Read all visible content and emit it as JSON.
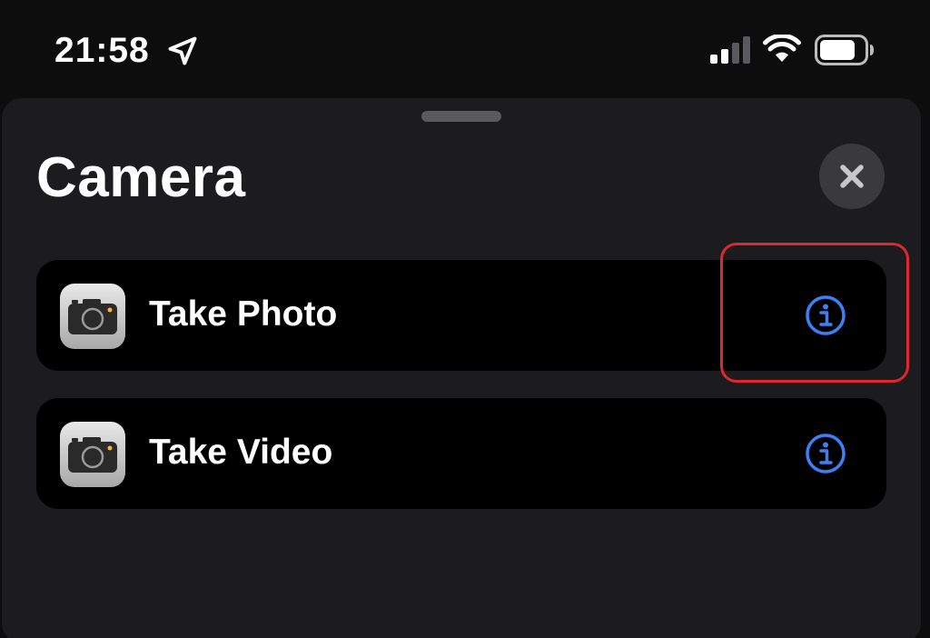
{
  "status_bar": {
    "time": "21:58",
    "icons": [
      "location-arrow-icon",
      "signal-icon",
      "wifi-icon",
      "battery-icon"
    ]
  },
  "sheet": {
    "title": "Camera",
    "close_icon": "close-icon",
    "actions": [
      {
        "label": "Take Photo",
        "app_icon": "camera-app-icon",
        "info_icon": "info-icon"
      },
      {
        "label": "Take Video",
        "app_icon": "camera-app-icon",
        "info_icon": "info-icon"
      }
    ]
  },
  "colors": {
    "accent": "#3c80f6",
    "sheet_background": "#1c1c1e",
    "row_background": "#000000",
    "highlight": "#e0262e"
  }
}
